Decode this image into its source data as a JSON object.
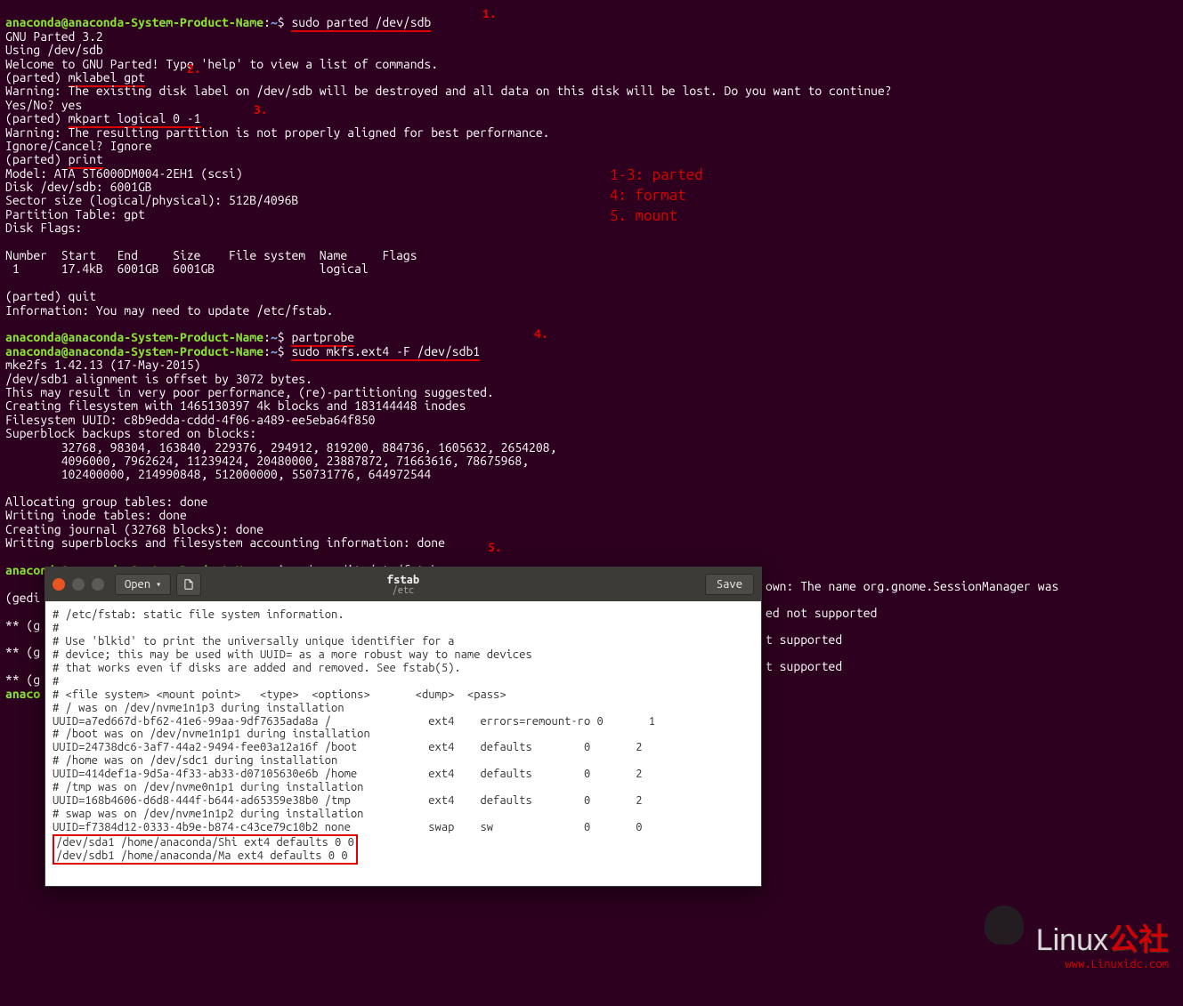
{
  "prompt": {
    "userhost": "anaconda@anaconda-System-Product-Name",
    "colon": ":",
    "path": "~",
    "dollar": "$"
  },
  "cmds": {
    "c1": "sudo parted /dev/sdb",
    "partprobe": "partprobe",
    "c4": "sudo mkfs.ext4 -F /dev/sdb1",
    "c5": "sudo gedit /etc/fstab"
  },
  "parted": {
    "version": "GNU Parted 3.2",
    "using": "Using /dev/sdb",
    "welcome": "Welcome to GNU Parted! Type 'help' to view a list of commands.",
    "prompt": "(parted) ",
    "mklabel": "mklabel gpt",
    "warn1": "Warning: The existing disk label on /dev/sdb will be destroyed and all data on this disk will be lost. Do you want to continue?",
    "yesno": "Yes/No? yes",
    "mkpart": "mkpart logical 0 -1",
    "warn2": "Warning: The resulting partition is not properly aligned for best performance.",
    "ignore": "Ignore/Cancel? Ignore",
    "print": "print",
    "model": "Model: ATA ST6000DM004-2EH1 (scsi)",
    "disk": "Disk /dev/sdb: 6001GB",
    "sector": "Sector size (logical/physical): 512B/4096B",
    "ptable": "Partition Table: gpt",
    "dflags": "Disk Flags:",
    "header": "Number  Start   End     Size    File system  Name     Flags",
    "row": " 1      17.4kB  6001GB  6001GB               logical",
    "quit": "(parted) quit",
    "info": "Information: You may need to update /etc/fstab."
  },
  "mkfs": {
    "l1": "mke2fs 1.42.13 (17-May-2015)",
    "l2": "/dev/sdb1 alignment is offset by 3072 bytes.",
    "l3": "This may result in very poor performance, (re)-partitioning suggested.",
    "l4": "Creating filesystem with 1465130397 4k blocks and 183144448 inodes",
    "l5": "Filesystem UUID: c8b9edda-cddd-4f06-a489-ee5eba64f850",
    "l6": "Superblock backups stored on blocks:",
    "l7": "        32768, 98304, 163840, 229376, 294912, 819200, 884736, 1605632, 2654208,",
    "l8": "        4096000, 7962624, 11239424, 20480000, 23887872, 71663616, 78675968,",
    "l9": "        102400000, 214990848, 512000000, 550731776, 644972544",
    "l10": "Allocating group tables: done",
    "l11": "Writing inode tables: done",
    "l12": "Creating journal (32768 blocks): done",
    "l13": "Writing superblocks and filesystem accounting information: done"
  },
  "tail": {
    "l1": "(gedi",
    "l1b": "own: The name org.gnome.SessionManager was",
    "l2a": "** (g",
    "l2b": "ed not supported",
    "l3a": "** (g",
    "l3b": "t supported",
    "l4a": "** (g",
    "l4b": "t supported",
    "l5": "anaco"
  },
  "annotations": {
    "a1": "1.",
    "a2": "2.",
    "a3": "3.",
    "a4": "4.",
    "a5": "5.",
    "legend1": "1-3: parted",
    "legend2": "4: format",
    "legend3": "5. mount"
  },
  "gedit": {
    "open": "Open",
    "save": "Save",
    "filename": "fstab",
    "filedir": "/etc",
    "content": {
      "l1": "# /etc/fstab: static file system information.",
      "l2": "#",
      "l3": "# Use 'blkid' to print the universally unique identifier for a",
      "l4": "# device; this may be used with UUID= as a more robust way to name devices",
      "l5": "# that works even if disks are added and removed. See fstab(5).",
      "l6": "#",
      "l7": "# <file system> <mount point>   <type>  <options>       <dump>  <pass>",
      "l8": "# / was on /dev/nvme1n1p3 during installation",
      "l9": "UUID=a7ed667d-bf62-41e6-99aa-9df7635ada8a /               ext4    errors=remount-ro 0       1",
      "l10": "# /boot was on /dev/nvme1n1p1 during installation",
      "l11": "UUID=24738dc6-3af7-44a2-9494-fee03a12a16f /boot           ext4    defaults        0       2",
      "l12": "# /home was on /dev/sdc1 during installation",
      "l13": "UUID=414def1a-9d5a-4f33-ab33-d07105630e6b /home           ext4    defaults        0       2",
      "l14": "# /tmp was on /dev/nvme0n1p1 during installation",
      "l15": "UUID=168b4606-d6d8-444f-b644-ad65359e38b0 /tmp            ext4    defaults        0       2",
      "l16": "# swap was on /dev/nvme1n1p2 during installation",
      "l17": "UUID=f7384d12-0333-4b9e-b874-c43ce79c10b2 none            swap    sw              0       0",
      "l18": "/dev/sda1 /home/anaconda/Shi ext4 defaults 0 0",
      "l19": "/dev/sdb1 /home/anaconda/Ma ext4 defaults 0 0"
    }
  },
  "watermark": {
    "brand": "Linux",
    "hanzi": "公社",
    "site": "www.Linuxidc.com"
  }
}
